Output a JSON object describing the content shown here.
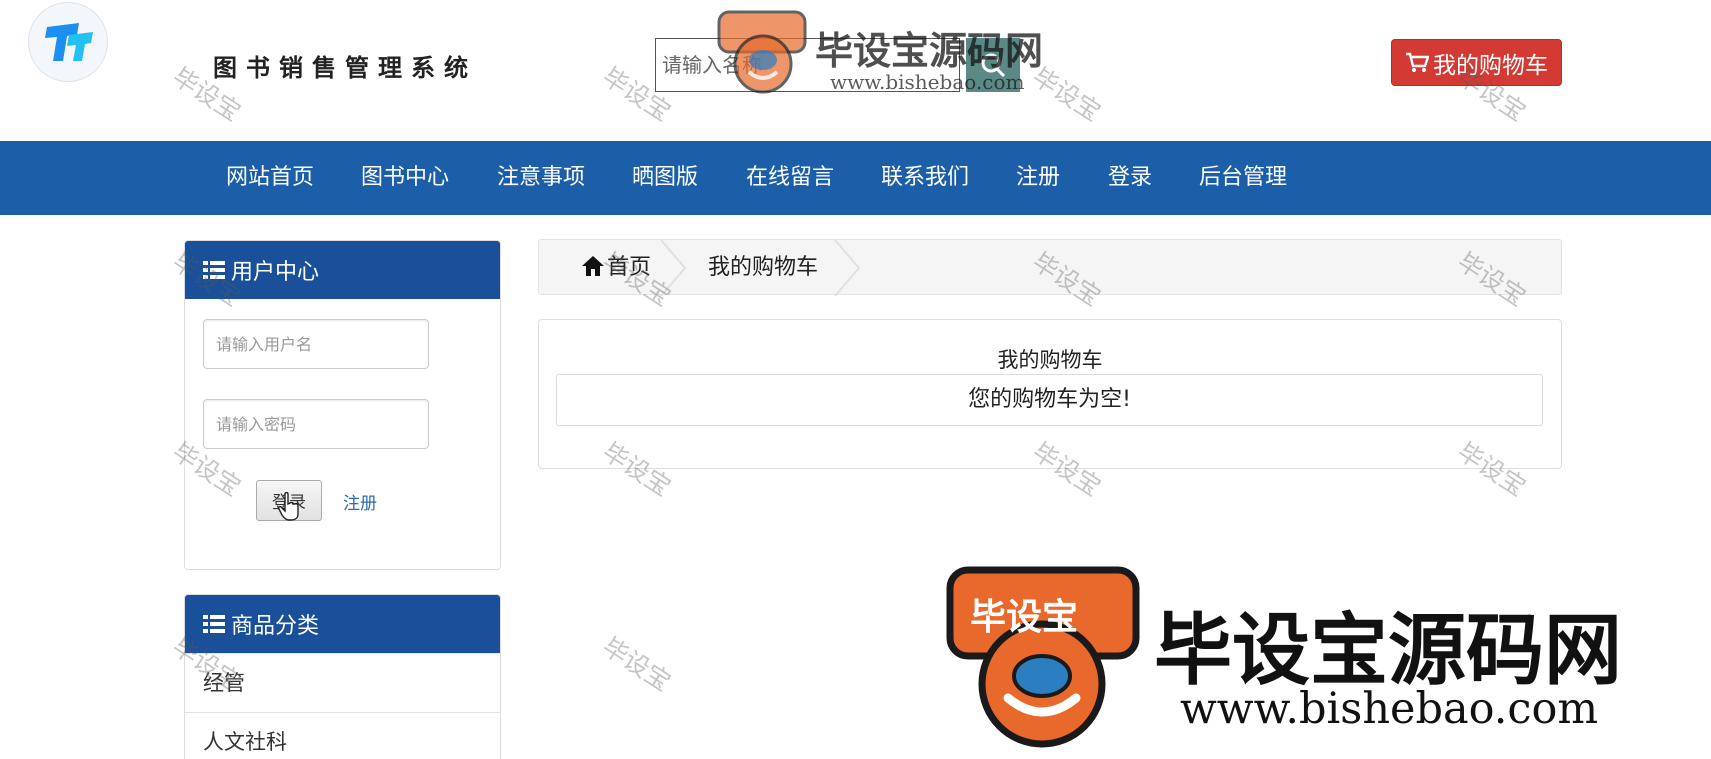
{
  "header": {
    "site_title": "图书销售管理系统",
    "search_placeholder": "请输入名称",
    "cart_button": "我的购物车"
  },
  "nav": {
    "items": [
      "网站首页",
      "图书中心",
      "注意事项",
      "晒图版",
      "在线留言",
      "联系我们",
      "注册",
      "登录",
      "后台管理"
    ]
  },
  "sidebar": {
    "user_panel": {
      "title": "用户中心",
      "username_placeholder": "请输入用户名",
      "password_placeholder": "请输入密码",
      "login_button": "登录",
      "register_link": "注册"
    },
    "category_panel": {
      "title": "商品分类",
      "items": [
        "经管",
        "人文社科"
      ]
    }
  },
  "main": {
    "breadcrumb": [
      "首页",
      "我的购物车"
    ],
    "cart": {
      "heading": "我的购物车",
      "empty_message": "您的购物车为空!"
    }
  },
  "watermark": {
    "text": "毕设宝",
    "brand_name": "毕设宝源码网",
    "brand_badge": "毕设宝",
    "brand_url": "www.bishebao.com"
  },
  "colors": {
    "nav_bg": "#1c5fa8",
    "panel_head_bg": "#1a5099",
    "cart_button_bg": "#d33a34",
    "brand_orange": "#e8692b"
  },
  "icons": [
    "app-logo-icon",
    "search-icon",
    "cart-icon",
    "list-icon",
    "home-icon"
  ]
}
